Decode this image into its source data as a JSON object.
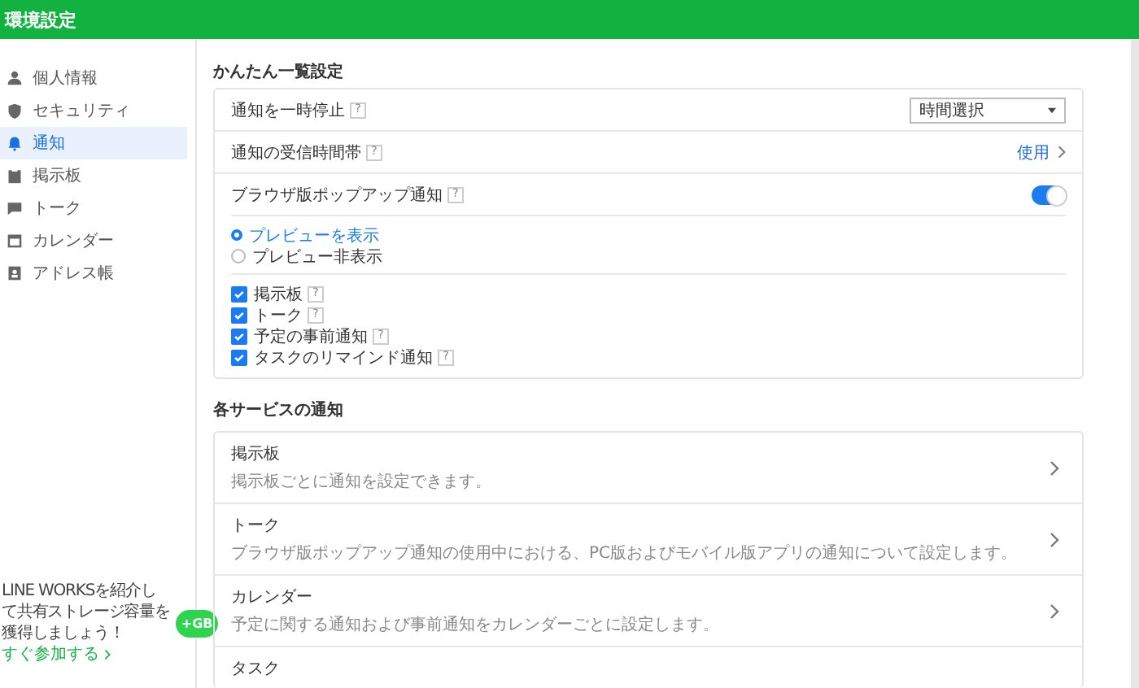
{
  "window": {
    "title": "環境設定"
  },
  "sidebar": {
    "items": [
      {
        "label": "個人情報",
        "selected": false
      },
      {
        "label": "セキュリティ",
        "selected": false
      },
      {
        "label": "通知",
        "selected": true
      },
      {
        "label": "掲示板",
        "selected": false
      },
      {
        "label": "トーク",
        "selected": false
      },
      {
        "label": "カレンダー",
        "selected": false
      },
      {
        "label": "アドレス帳",
        "selected": false
      }
    ],
    "promo": {
      "lines": [
        "LINE WORKSを紹介し",
        "て共有ストレージ容量を",
        "獲得しましょう！"
      ],
      "link": "すぐ参加する",
      "badge": "+GB"
    }
  },
  "quick_settings": {
    "title": "かんたん一覧設定",
    "rows": [
      {
        "kind": "select",
        "label": "通知を一時停止",
        "help": "?",
        "value": "時間選択"
      },
      {
        "kind": "link",
        "label": "通知の受信時間帯",
        "help": "?",
        "value": "使用"
      },
      {
        "kind": "toggle",
        "label": "ブラウザ版ポップアップ通知",
        "help": "?",
        "on": true
      }
    ],
    "preview_options": [
      {
        "label": "プレビューを表示",
        "selected": true
      },
      {
        "label": "プレビュー非表示",
        "selected": false
      }
    ],
    "checks": [
      {
        "label": "掲示板",
        "help": "?",
        "checked": true
      },
      {
        "label": "トーク",
        "help": "?",
        "checked": true
      },
      {
        "label": "予定の事前通知",
        "help": "?",
        "checked": true
      },
      {
        "label": "タスクのリマインド通知",
        "help": "?",
        "checked": true
      }
    ]
  },
  "services": {
    "title": "各サービスの通知",
    "items": [
      {
        "title": "掲示板",
        "description": "掲示板ごとに通知を設定できます。"
      },
      {
        "title": "トーク",
        "description": "ブラウザ版ポップアップ通知の使用中における、PC版およびモバイル版アプリの通知について設定します。"
      },
      {
        "title": "カレンダー",
        "description": "予定に関する通知および事前通知をカレンダーごとに設定します。"
      },
      {
        "title": "タスク"
      }
    ]
  }
}
